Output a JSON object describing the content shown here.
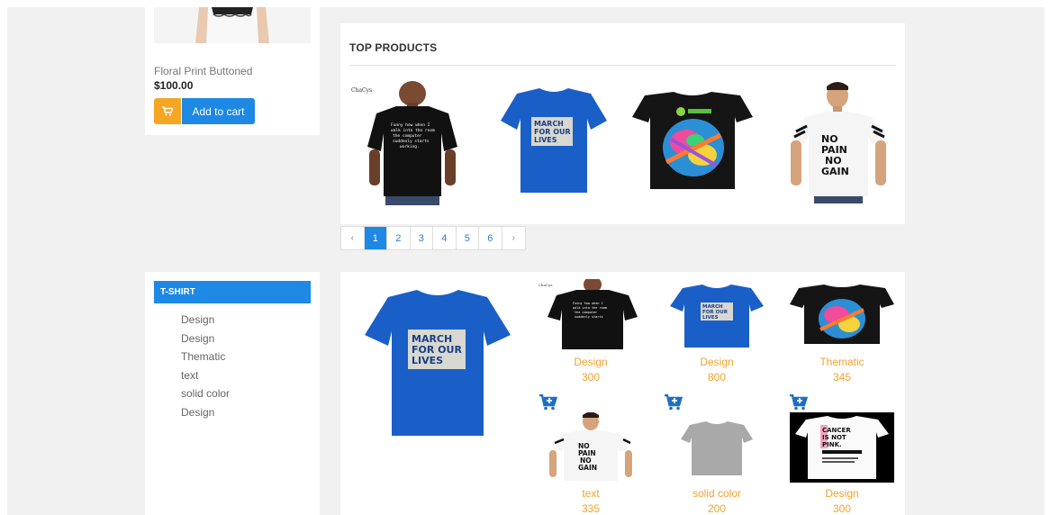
{
  "featured": {
    "name": "Floral Print Buttoned",
    "price": "$100.00",
    "add_label": "Add to cart"
  },
  "top_products": {
    "title": "TOP PRODUCTS",
    "shirt1_brand": "ChaCys"
  },
  "pagination": {
    "prev": "‹",
    "pages": [
      "1",
      "2",
      "3",
      "4",
      "5",
      "6"
    ],
    "next": "›",
    "active": "1"
  },
  "category": {
    "heading": "T-SHIRT",
    "items": [
      "Design",
      "Design",
      "Thematic",
      "text",
      "solid color",
      "Design"
    ]
  },
  "grid": {
    "items": [
      {
        "name": "Design",
        "price": "300"
      },
      {
        "name": "Design",
        "price": "800"
      },
      {
        "name": "Thematic",
        "price": "345"
      },
      {
        "name": "text",
        "price": "335"
      },
      {
        "name": "solid color",
        "price": "200"
      },
      {
        "name": "Design",
        "price": "300"
      }
    ]
  },
  "shirt_text": {
    "march": [
      "MARCH",
      "FOR OUR",
      "LIVES"
    ],
    "nopain": [
      "NO",
      "PAIN",
      "NO",
      "GAIN"
    ],
    "cancer": [
      "CANCER",
      "IS NOT",
      "PINK."
    ]
  },
  "colors": {
    "accent": "#1e88e5",
    "cart": "#f5a623",
    "item_text": "#f0a330"
  }
}
